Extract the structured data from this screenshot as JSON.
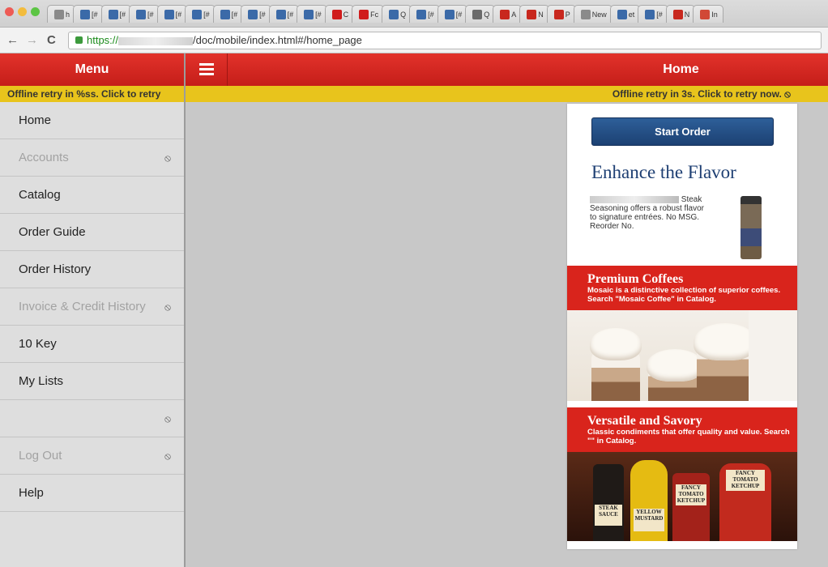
{
  "browser": {
    "tabs": [
      {
        "label": "h",
        "icon": "page-icon",
        "color": "#8a8a8a"
      },
      {
        "label": "[#",
        "icon": "x-logo-icon",
        "color": "#3b6aa8"
      },
      {
        "label": "[#",
        "icon": "x-logo-icon",
        "color": "#3b6aa8"
      },
      {
        "label": "[#",
        "icon": "x-logo-icon",
        "color": "#3b6aa8"
      },
      {
        "label": "[#",
        "icon": "x-logo-icon",
        "color": "#3b6aa8"
      },
      {
        "label": "[#",
        "icon": "x-logo-icon",
        "color": "#3b6aa8"
      },
      {
        "label": "[#",
        "icon": "x-logo-icon",
        "color": "#3b6aa8"
      },
      {
        "label": "[#",
        "icon": "x-logo-icon",
        "color": "#3b6aa8"
      },
      {
        "label": "[#",
        "icon": "x-logo-icon",
        "color": "#3b6aa8"
      },
      {
        "label": "[#",
        "icon": "x-logo-icon",
        "color": "#3b6aa8"
      },
      {
        "label": "C",
        "icon": "youtube-icon",
        "color": "#d01c1c"
      },
      {
        "label": "Fc",
        "icon": "youtube-icon",
        "color": "#d01c1c"
      },
      {
        "label": "Q",
        "icon": "x-logo-icon",
        "color": "#3b6aa8"
      },
      {
        "label": "[#",
        "icon": "x-logo-icon",
        "color": "#3b6aa8"
      },
      {
        "label": "[#",
        "icon": "x-logo-icon",
        "color": "#3b6aa8"
      },
      {
        "label": "Q",
        "icon": "qa-icon",
        "color": "#6b6b6b"
      },
      {
        "label": "A",
        "icon": "sfs-icon",
        "color": "#c8281e"
      },
      {
        "label": "N",
        "icon": "sfs-icon",
        "color": "#c8281e"
      },
      {
        "label": "P",
        "icon": "sfs-icon",
        "color": "#c8281e"
      },
      {
        "label": "New",
        "icon": "page-icon",
        "color": "#8a8a8a"
      },
      {
        "label": "et",
        "icon": "loading-icon",
        "color": "#3b6aa8"
      },
      {
        "label": "[#",
        "icon": "x-logo-icon",
        "color": "#3b6aa8"
      },
      {
        "label": "N",
        "icon": "sfs-icon",
        "color": "#c8281e"
      },
      {
        "label": "In",
        "icon": "gmail-icon",
        "color": "#d14836"
      }
    ],
    "url_scheme": "https://",
    "url_rest": "/doc/mobile/index.html#/home_page"
  },
  "menu": {
    "title": "Menu",
    "banner": "Offline retry in %ss. Click to retry",
    "items": [
      {
        "label": "Home",
        "disabled": false,
        "blocked": false
      },
      {
        "label": "Accounts",
        "disabled": true,
        "blocked": true
      },
      {
        "label": "Catalog",
        "disabled": false,
        "blocked": false
      },
      {
        "label": "Order Guide",
        "disabled": false,
        "blocked": false
      },
      {
        "label": "Order History",
        "disabled": false,
        "blocked": false
      },
      {
        "label": "Invoice & Credit History",
        "disabled": true,
        "blocked": true
      },
      {
        "label": "10 Key",
        "disabled": false,
        "blocked": false
      },
      {
        "label": "My Lists",
        "disabled": false,
        "blocked": false
      },
      {
        "label": "",
        "disabled": true,
        "blocked": true
      },
      {
        "label": "Log Out",
        "disabled": true,
        "blocked": true
      },
      {
        "label": "Help",
        "disabled": false,
        "blocked": false
      }
    ]
  },
  "main": {
    "title": "Home",
    "banner": "Offline retry in 3s. Click to retry now. ⦸",
    "start_order": "Start Order",
    "flavor_title": "Enhance the Flavor",
    "flavor_text": "Steak Seasoning offers a robust flavor to signature entrées. No MSG. Reorder No.",
    "promo1_title": "Premium Coffees",
    "promo1_text": "Mosaic is a distinctive collection of superior coffees. Search \"Mosaic Coffee\" in Catalog.",
    "promo2_title": "Versatile and Savory",
    "promo2_text": "Classic condiments that offer quality and value. Search \"\" in Catalog.",
    "sauce_labels": [
      "STEAK SAUCE",
      "YELLOW MUSTARD",
      "FANCY TOMATO KETCHUP",
      "FANCY TOMATO KETCHUP"
    ]
  },
  "colors": {
    "header_red": "#d4261f",
    "banner_yellow": "#e8c41c",
    "button_blue": "#1f4a80"
  }
}
